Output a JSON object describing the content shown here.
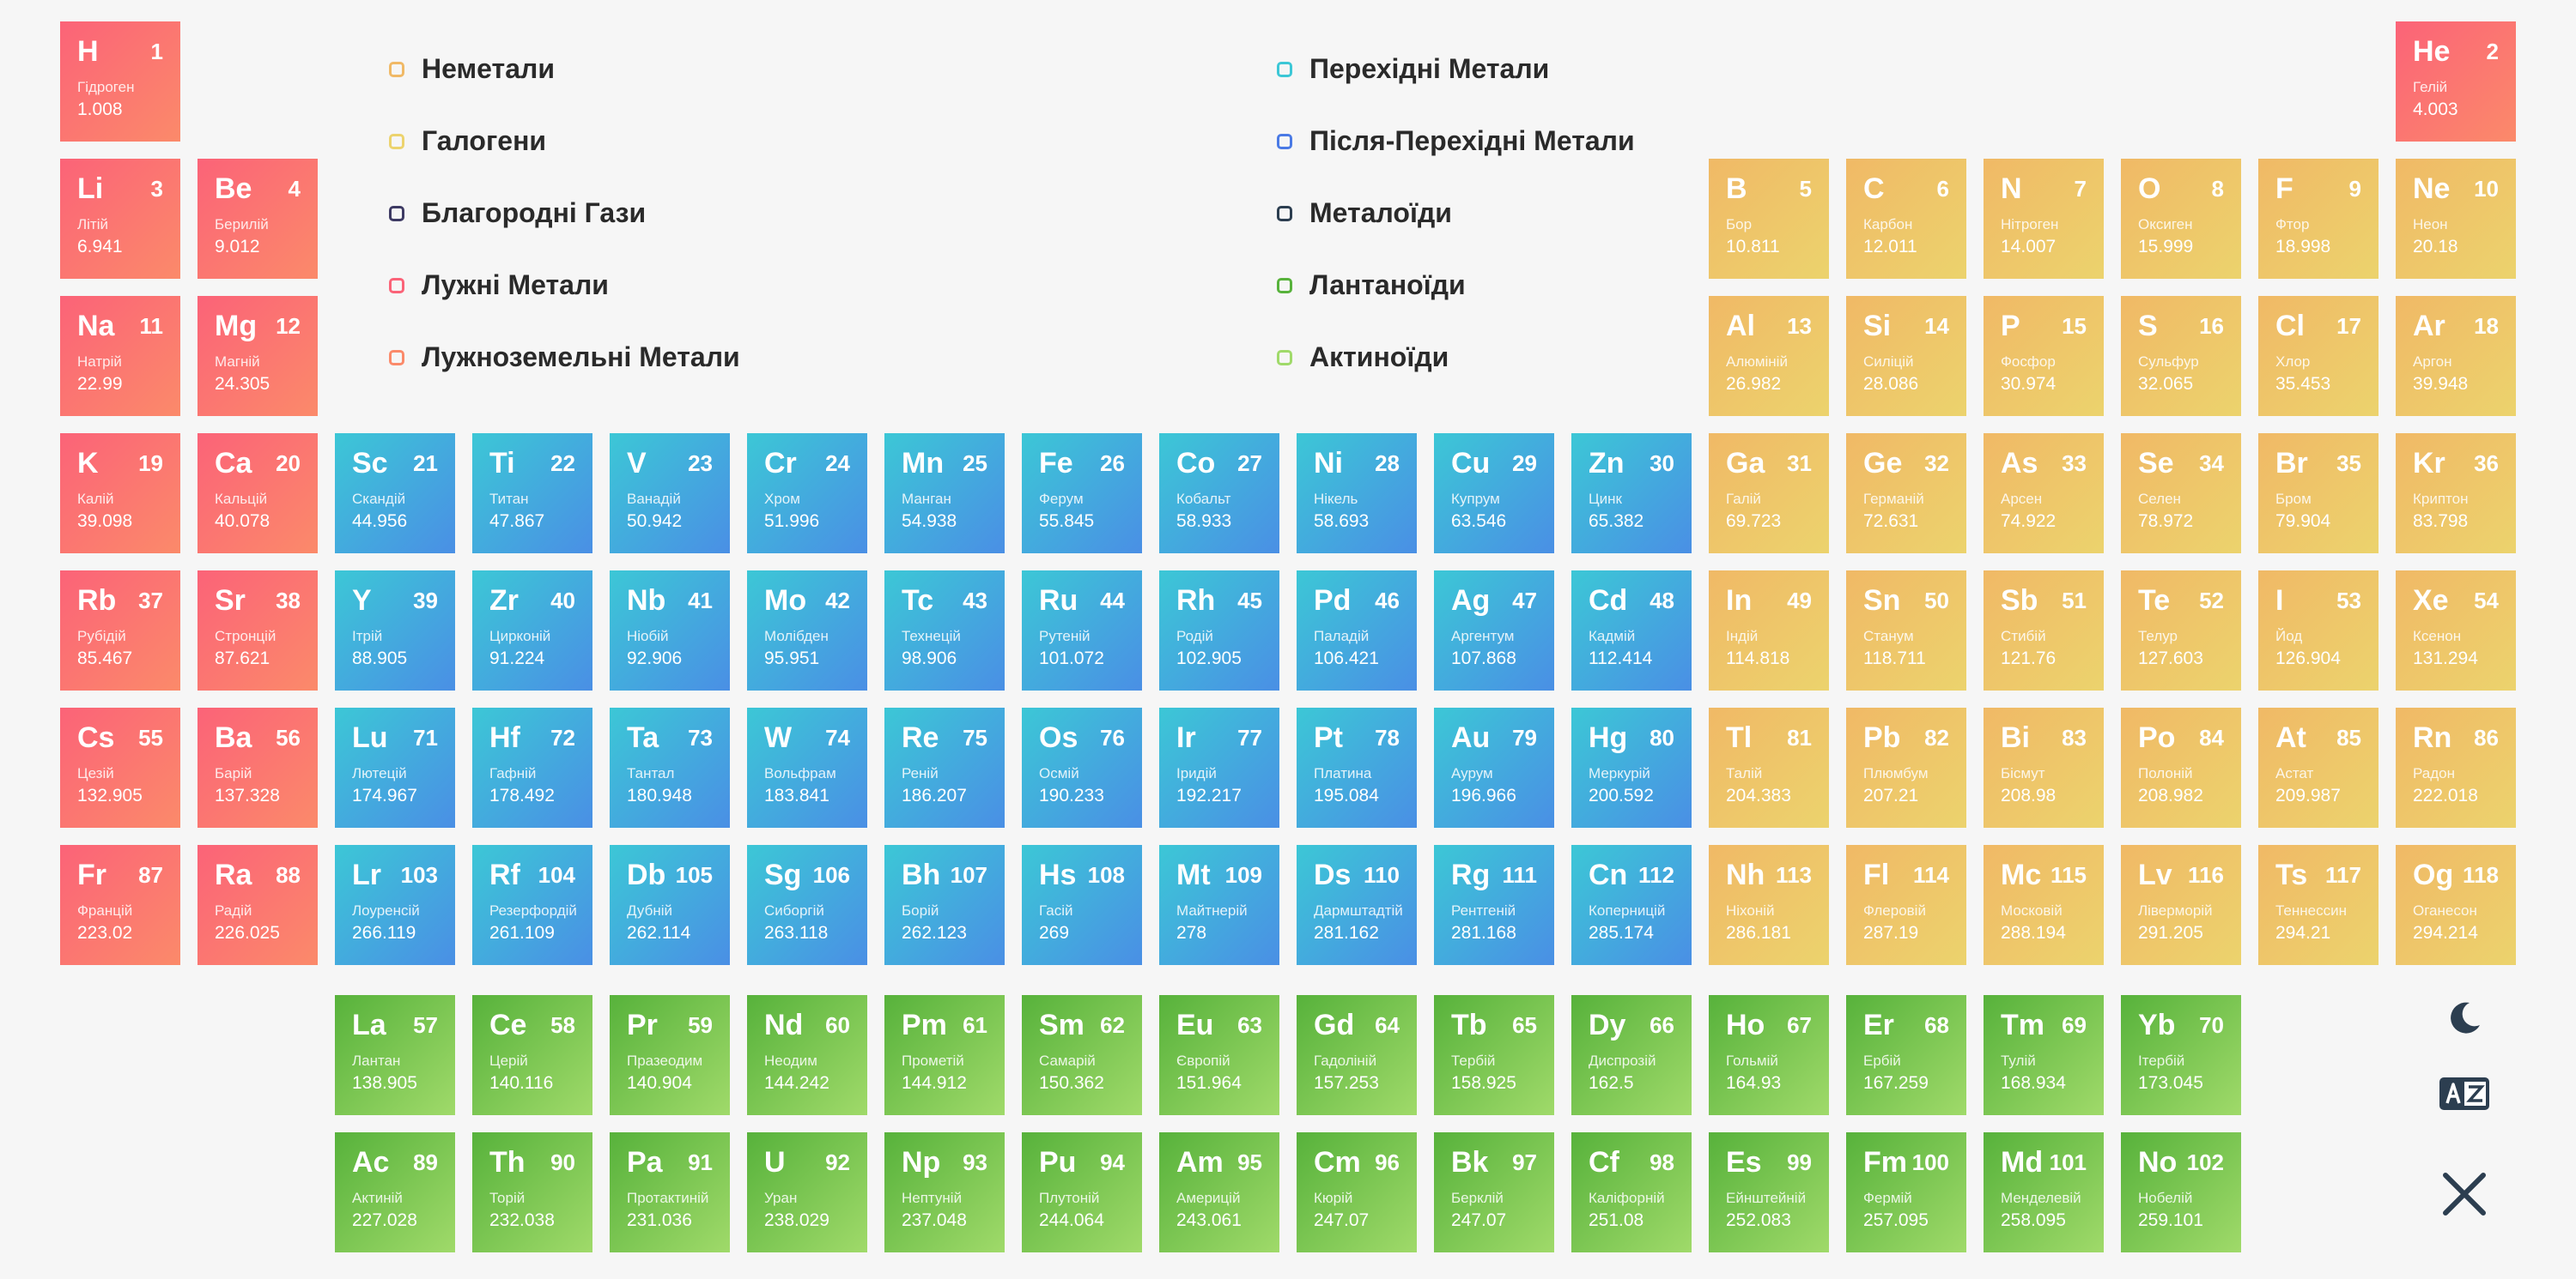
{
  "legend": [
    {
      "label": "Неметали",
      "color": "#f0b966"
    },
    {
      "label": "Галогени",
      "color": "#ecd36d"
    },
    {
      "label": "Благородні Гази",
      "color": "#3d3a63"
    },
    {
      "label": "Лужні Метали",
      "color": "#fb6378"
    },
    {
      "label": "Лужноземельні Метали",
      "color": "#fb8a6a"
    },
    {
      "label": "Перехідні Метали",
      "color": "#3cc7d6"
    },
    {
      "label": "Після-Перехідні Метали",
      "color": "#4a7ae5"
    },
    {
      "label": "Металоїди",
      "color": "#2c3e50"
    },
    {
      "label": "Лантаноїди",
      "color": "#57b23b"
    },
    {
      "label": "Актиноїди",
      "color": "#a0da6a"
    }
  ],
  "controls": {
    "theme_icon": "moon-icon",
    "language_icon": "translate-icon",
    "close_icon": "close-icon"
  },
  "elements": [
    {
      "n": 1,
      "s": "H",
      "name": "Гідроген",
      "m": "1.008",
      "cat": "alkali"
    },
    {
      "n": 2,
      "s": "He",
      "name": "Гелій",
      "m": "4.003",
      "cat": "alkali"
    },
    {
      "n": 3,
      "s": "Li",
      "name": "Літій",
      "m": "6.941",
      "cat": "alkali"
    },
    {
      "n": 4,
      "s": "Be",
      "name": "Берилій",
      "m": "9.012",
      "cat": "alkali"
    },
    {
      "n": 5,
      "s": "B",
      "name": "Бор",
      "m": "10.811",
      "cat": "nonmetal"
    },
    {
      "n": 6,
      "s": "C",
      "name": "Карбон",
      "m": "12.011",
      "cat": "nonmetal"
    },
    {
      "n": 7,
      "s": "N",
      "name": "Нітроген",
      "m": "14.007",
      "cat": "nonmetal"
    },
    {
      "n": 8,
      "s": "O",
      "name": "Оксиген",
      "m": "15.999",
      "cat": "nonmetal"
    },
    {
      "n": 9,
      "s": "F",
      "name": "Фтор",
      "m": "18.998",
      "cat": "nonmetal"
    },
    {
      "n": 10,
      "s": "Ne",
      "name": "Неон",
      "m": "20.18",
      "cat": "nonmetal"
    },
    {
      "n": 11,
      "s": "Na",
      "name": "Натрій",
      "m": "22.99",
      "cat": "alkali"
    },
    {
      "n": 12,
      "s": "Mg",
      "name": "Магній",
      "m": "24.305",
      "cat": "alkali"
    },
    {
      "n": 13,
      "s": "Al",
      "name": "Алюміній",
      "m": "26.982",
      "cat": "nonmetal"
    },
    {
      "n": 14,
      "s": "Si",
      "name": "Силіцій",
      "m": "28.086",
      "cat": "nonmetal"
    },
    {
      "n": 15,
      "s": "P",
      "name": "Фосфор",
      "m": "30.974",
      "cat": "nonmetal"
    },
    {
      "n": 16,
      "s": "S",
      "name": "Сульфур",
      "m": "32.065",
      "cat": "nonmetal"
    },
    {
      "n": 17,
      "s": "Cl",
      "name": "Хлор",
      "m": "35.453",
      "cat": "nonmetal"
    },
    {
      "n": 18,
      "s": "Ar",
      "name": "Аргон",
      "m": "39.948",
      "cat": "nonmetal"
    },
    {
      "n": 19,
      "s": "K",
      "name": "Калій",
      "m": "39.098",
      "cat": "alkali"
    },
    {
      "n": 20,
      "s": "Ca",
      "name": "Кальцій",
      "m": "40.078",
      "cat": "alkali"
    },
    {
      "n": 21,
      "s": "Sc",
      "name": "Скандій",
      "m": "44.956",
      "cat": "transition"
    },
    {
      "n": 22,
      "s": "Ti",
      "name": "Титан",
      "m": "47.867",
      "cat": "transition"
    },
    {
      "n": 23,
      "s": "V",
      "name": "Ванадій",
      "m": "50.942",
      "cat": "transition"
    },
    {
      "n": 24,
      "s": "Cr",
      "name": "Хром",
      "m": "51.996",
      "cat": "transition"
    },
    {
      "n": 25,
      "s": "Mn",
      "name": "Манган",
      "m": "54.938",
      "cat": "transition"
    },
    {
      "n": 26,
      "s": "Fe",
      "name": "Ферум",
      "m": "55.845",
      "cat": "transition"
    },
    {
      "n": 27,
      "s": "Co",
      "name": "Кобальт",
      "m": "58.933",
      "cat": "transition"
    },
    {
      "n": 28,
      "s": "Ni",
      "name": "Нікель",
      "m": "58.693",
      "cat": "transition"
    },
    {
      "n": 29,
      "s": "Cu",
      "name": "Купрум",
      "m": "63.546",
      "cat": "transition"
    },
    {
      "n": 30,
      "s": "Zn",
      "name": "Цинк",
      "m": "65.382",
      "cat": "transition"
    },
    {
      "n": 31,
      "s": "Ga",
      "name": "Галій",
      "m": "69.723",
      "cat": "nonmetal"
    },
    {
      "n": 32,
      "s": "Ge",
      "name": "Германій",
      "m": "72.631",
      "cat": "nonmetal"
    },
    {
      "n": 33,
      "s": "As",
      "name": "Арсен",
      "m": "74.922",
      "cat": "nonmetal"
    },
    {
      "n": 34,
      "s": "Se",
      "name": "Селен",
      "m": "78.972",
      "cat": "nonmetal"
    },
    {
      "n": 35,
      "s": "Br",
      "name": "Бром",
      "m": "79.904",
      "cat": "nonmetal"
    },
    {
      "n": 36,
      "s": "Kr",
      "name": "Криптон",
      "m": "83.798",
      "cat": "nonmetal"
    },
    {
      "n": 37,
      "s": "Rb",
      "name": "Рубідій",
      "m": "85.467",
      "cat": "alkali"
    },
    {
      "n": 38,
      "s": "Sr",
      "name": "Стронцій",
      "m": "87.621",
      "cat": "alkali"
    },
    {
      "n": 39,
      "s": "Y",
      "name": "Ітрій",
      "m": "88.905",
      "cat": "transition"
    },
    {
      "n": 40,
      "s": "Zr",
      "name": "Цирконій",
      "m": "91.224",
      "cat": "transition"
    },
    {
      "n": 41,
      "s": "Nb",
      "name": "Ніобій",
      "m": "92.906",
      "cat": "transition"
    },
    {
      "n": 42,
      "s": "Mo",
      "name": "Молібден",
      "m": "95.951",
      "cat": "transition"
    },
    {
      "n": 43,
      "s": "Tc",
      "name": "Технецій",
      "m": "98.906",
      "cat": "transition"
    },
    {
      "n": 44,
      "s": "Ru",
      "name": "Рутеній",
      "m": "101.072",
      "cat": "transition"
    },
    {
      "n": 45,
      "s": "Rh",
      "name": "Родій",
      "m": "102.905",
      "cat": "transition"
    },
    {
      "n": 46,
      "s": "Pd",
      "name": "Паладій",
      "m": "106.421",
      "cat": "transition"
    },
    {
      "n": 47,
      "s": "Ag",
      "name": "Аргентум",
      "m": "107.868",
      "cat": "transition"
    },
    {
      "n": 48,
      "s": "Cd",
      "name": "Кадмій",
      "m": "112.414",
      "cat": "transition"
    },
    {
      "n": 49,
      "s": "In",
      "name": "Індій",
      "m": "114.818",
      "cat": "nonmetal"
    },
    {
      "n": 50,
      "s": "Sn",
      "name": "Станум",
      "m": "118.711",
      "cat": "nonmetal"
    },
    {
      "n": 51,
      "s": "Sb",
      "name": "Стибій",
      "m": "121.76",
      "cat": "nonmetal"
    },
    {
      "n": 52,
      "s": "Te",
      "name": "Телур",
      "m": "127.603",
      "cat": "nonmetal"
    },
    {
      "n": 53,
      "s": "I",
      "name": "Йод",
      "m": "126.904",
      "cat": "nonmetal"
    },
    {
      "n": 54,
      "s": "Xe",
      "name": "Ксенон",
      "m": "131.294",
      "cat": "nonmetal"
    },
    {
      "n": 55,
      "s": "Cs",
      "name": "Цезій",
      "m": "132.905",
      "cat": "alkali"
    },
    {
      "n": 56,
      "s": "Ba",
      "name": "Барій",
      "m": "137.328",
      "cat": "alkali"
    },
    {
      "n": 71,
      "s": "Lu",
      "name": "Лютецій",
      "m": "174.967",
      "cat": "transition"
    },
    {
      "n": 72,
      "s": "Hf",
      "name": "Гафній",
      "m": "178.492",
      "cat": "transition"
    },
    {
      "n": 73,
      "s": "Ta",
      "name": "Тантал",
      "m": "180.948",
      "cat": "transition"
    },
    {
      "n": 74,
      "s": "W",
      "name": "Вольфрам",
      "m": "183.841",
      "cat": "transition"
    },
    {
      "n": 75,
      "s": "Re",
      "name": "Реній",
      "m": "186.207",
      "cat": "transition"
    },
    {
      "n": 76,
      "s": "Os",
      "name": "Осмій",
      "m": "190.233",
      "cat": "transition"
    },
    {
      "n": 77,
      "s": "Ir",
      "name": "Іридій",
      "m": "192.217",
      "cat": "transition"
    },
    {
      "n": 78,
      "s": "Pt",
      "name": "Платина",
      "m": "195.084",
      "cat": "transition"
    },
    {
      "n": 79,
      "s": "Au",
      "name": "Аурум",
      "m": "196.966",
      "cat": "transition"
    },
    {
      "n": 80,
      "s": "Hg",
      "name": "Меркурій",
      "m": "200.592",
      "cat": "transition"
    },
    {
      "n": 81,
      "s": "Tl",
      "name": "Талій",
      "m": "204.383",
      "cat": "nonmetal"
    },
    {
      "n": 82,
      "s": "Pb",
      "name": "Плюмбум",
      "m": "207.21",
      "cat": "nonmetal"
    },
    {
      "n": 83,
      "s": "Bi",
      "name": "Бісмут",
      "m": "208.98",
      "cat": "nonmetal"
    },
    {
      "n": 84,
      "s": "Po",
      "name": "Полоній",
      "m": "208.982",
      "cat": "nonmetal"
    },
    {
      "n": 85,
      "s": "At",
      "name": "Астат",
      "m": "209.987",
      "cat": "nonmetal"
    },
    {
      "n": 86,
      "s": "Rn",
      "name": "Радон",
      "m": "222.018",
      "cat": "nonmetal"
    },
    {
      "n": 87,
      "s": "Fr",
      "name": "Францій",
      "m": "223.02",
      "cat": "alkali"
    },
    {
      "n": 88,
      "s": "Ra",
      "name": "Радій",
      "m": "226.025",
      "cat": "alkali"
    },
    {
      "n": 103,
      "s": "Lr",
      "name": "Лоуренсій",
      "m": "266.119",
      "cat": "transition"
    },
    {
      "n": 104,
      "s": "Rf",
      "name": "Резерфордій",
      "m": "261.109",
      "cat": "transition"
    },
    {
      "n": 105,
      "s": "Db",
      "name": "Дубній",
      "m": "262.114",
      "cat": "transition"
    },
    {
      "n": 106,
      "s": "Sg",
      "name": "Сиборгій",
      "m": "263.118",
      "cat": "transition"
    },
    {
      "n": 107,
      "s": "Bh",
      "name": "Борій",
      "m": "262.123",
      "cat": "transition"
    },
    {
      "n": 108,
      "s": "Hs",
      "name": "Гасій",
      "m": "269",
      "cat": "transition"
    },
    {
      "n": 109,
      "s": "Mt",
      "name": "Майтнерій",
      "m": "278",
      "cat": "transition"
    },
    {
      "n": 110,
      "s": "Ds",
      "name": "Дармштадтій",
      "m": "281.162",
      "cat": "transition"
    },
    {
      "n": 111,
      "s": "Rg",
      "name": "Рентгеній",
      "m": "281.168",
      "cat": "transition"
    },
    {
      "n": 112,
      "s": "Cn",
      "name": "Коперницій",
      "m": "285.174",
      "cat": "transition"
    },
    {
      "n": 113,
      "s": "Nh",
      "name": "Ніхоній",
      "m": "286.181",
      "cat": "nonmetal"
    },
    {
      "n": 114,
      "s": "Fl",
      "name": "Флеровій",
      "m": "287.19",
      "cat": "nonmetal"
    },
    {
      "n": 115,
      "s": "Mc",
      "name": "Московій",
      "m": "288.194",
      "cat": "nonmetal"
    },
    {
      "n": 116,
      "s": "Lv",
      "name": "Ліверморій",
      "m": "291.205",
      "cat": "nonmetal"
    },
    {
      "n": 117,
      "s": "Ts",
      "name": "Теннессин",
      "m": "294.21",
      "cat": "nonmetal"
    },
    {
      "n": 118,
      "s": "Og",
      "name": "Оганесон",
      "m": "294.214",
      "cat": "nonmetal"
    },
    {
      "n": 57,
      "s": "La",
      "name": "Лантан",
      "m": "138.905",
      "cat": "lanthanide"
    },
    {
      "n": 58,
      "s": "Ce",
      "name": "Церій",
      "m": "140.116",
      "cat": "lanthanide"
    },
    {
      "n": 59,
      "s": "Pr",
      "name": "Празеодим",
      "m": "140.904",
      "cat": "lanthanide"
    },
    {
      "n": 60,
      "s": "Nd",
      "name": "Неодим",
      "m": "144.242",
      "cat": "lanthanide"
    },
    {
      "n": 61,
      "s": "Pm",
      "name": "Прометій",
      "m": "144.912",
      "cat": "lanthanide"
    },
    {
      "n": 62,
      "s": "Sm",
      "name": "Самарій",
      "m": "150.362",
      "cat": "lanthanide"
    },
    {
      "n": 63,
      "s": "Eu",
      "name": "Європій",
      "m": "151.964",
      "cat": "lanthanide"
    },
    {
      "n": 64,
      "s": "Gd",
      "name": "Гадоліній",
      "m": "157.253",
      "cat": "lanthanide"
    },
    {
      "n": 65,
      "s": "Tb",
      "name": "Тербій",
      "m": "158.925",
      "cat": "lanthanide"
    },
    {
      "n": 66,
      "s": "Dy",
      "name": "Диспрозій",
      "m": "162.5",
      "cat": "lanthanide"
    },
    {
      "n": 67,
      "s": "Ho",
      "name": "Гольмій",
      "m": "164.93",
      "cat": "lanthanide"
    },
    {
      "n": 68,
      "s": "Er",
      "name": "Ербій",
      "m": "167.259",
      "cat": "lanthanide"
    },
    {
      "n": 69,
      "s": "Tm",
      "name": "Тулій",
      "m": "168.934",
      "cat": "lanthanide"
    },
    {
      "n": 70,
      "s": "Yb",
      "name": "Ітербій",
      "m": "173.045",
      "cat": "lanthanide"
    },
    {
      "n": 89,
      "s": "Ac",
      "name": "Актиній",
      "m": "227.028",
      "cat": "lanthanide"
    },
    {
      "n": 90,
      "s": "Th",
      "name": "Торій",
      "m": "232.038",
      "cat": "lanthanide"
    },
    {
      "n": 91,
      "s": "Pa",
      "name": "Протактиній",
      "m": "231.036",
      "cat": "lanthanide"
    },
    {
      "n": 92,
      "s": "U",
      "name": "Уран",
      "m": "238.029",
      "cat": "lanthanide"
    },
    {
      "n": 93,
      "s": "Np",
      "name": "Нептуній",
      "m": "237.048",
      "cat": "lanthanide"
    },
    {
      "n": 94,
      "s": "Pu",
      "name": "Плутоній",
      "m": "244.064",
      "cat": "lanthanide"
    },
    {
      "n": 95,
      "s": "Am",
      "name": "Америцій",
      "m": "243.061",
      "cat": "lanthanide"
    },
    {
      "n": 96,
      "s": "Cm",
      "name": "Кюрій",
      "m": "247.07",
      "cat": "lanthanide"
    },
    {
      "n": 97,
      "s": "Bk",
      "name": "Берклій",
      "m": "247.07",
      "cat": "lanthanide"
    },
    {
      "n": 98,
      "s": "Cf",
      "name": "Каліфорній",
      "m": "251.08",
      "cat": "lanthanide"
    },
    {
      "n": 99,
      "s": "Es",
      "name": "Ейнштейній",
      "m": "252.083",
      "cat": "lanthanide"
    },
    {
      "n": 100,
      "s": "Fm",
      "name": "Фермій",
      "m": "257.095",
      "cat": "lanthanide"
    },
    {
      "n": 101,
      "s": "Md",
      "name": "Менделевій",
      "m": "258.095",
      "cat": "lanthanide"
    },
    {
      "n": 102,
      "s": "No",
      "name": "Нобелій",
      "m": "259.101",
      "cat": "lanthanide"
    }
  ]
}
